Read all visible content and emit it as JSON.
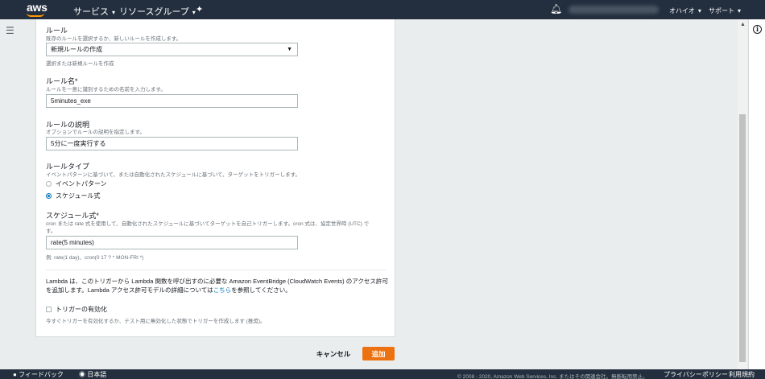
{
  "topnav": {
    "logo": "aws",
    "services": "サービス",
    "resource_groups": "リソースグループ",
    "region": "オハイオ",
    "support": "サポート"
  },
  "form": {
    "rule": {
      "label": "ルール",
      "description": "既存のルールを選択するか、新しいルールを作成します。",
      "value": "新規ルールの作成",
      "hint": "選択または新規ルールを作成"
    },
    "rule_name": {
      "label": "ルール名*",
      "description": "ルールを一意に識別するための名前を入力します。",
      "value": "5minutes_exe"
    },
    "rule_description": {
      "label": "ルールの説明",
      "description": "オプションでルールの説明を指定します。",
      "value": "5分に一度実行する"
    },
    "rule_type": {
      "label": "ルールタイプ",
      "description": "イベントパターンに基づいて、または自動化されたスケジュールに基づいて、ターゲットをトリガーします。",
      "options": [
        "イベントパターン",
        "スケジュール式"
      ],
      "selected": "スケジュール式"
    },
    "schedule": {
      "label": "スケジュール式*",
      "description_line1": "cron または rate 式を使用して、自動化されたスケジュールに基づいてターゲットを自己トリガーします。cron 式は、協定世界時 (UTC) で",
      "description_line2": "す。",
      "value": "rate(5 minutes)",
      "hint": "例: rate(1 day)、cron(0 17 ? * MON-FRI *)"
    },
    "permission": {
      "text_before": "Lambda は、このトリガーから Lambda 関数を呼び出すのに必要な Amazon EventBridge (CloudWatch Events) のアクセス許可を追加します。Lambda アクセス許可モデルの詳細については",
      "link": "こちら",
      "text_after": "を参照してください。"
    },
    "enable_trigger": {
      "label": "トリガーの有効化",
      "description": "今すぐトリガーを有効化するか、テスト用に無効化した状態でトリガーを作成します (推奨)。",
      "checked": false
    }
  },
  "actions": {
    "cancel": "キャンセル",
    "add": "追加"
  },
  "footer": {
    "feedback": "フィードバック",
    "language": "日本語",
    "copyright": "© 2008 - 2020, Amazon Web Services, Inc. またはその関連会社。無断転用禁止。",
    "privacy": "プライバシーポリシー",
    "terms": "利用規約"
  },
  "colors": {
    "nav_bg": "#232f3e",
    "primary_button": "#ec7211",
    "link": "#0073bb"
  }
}
